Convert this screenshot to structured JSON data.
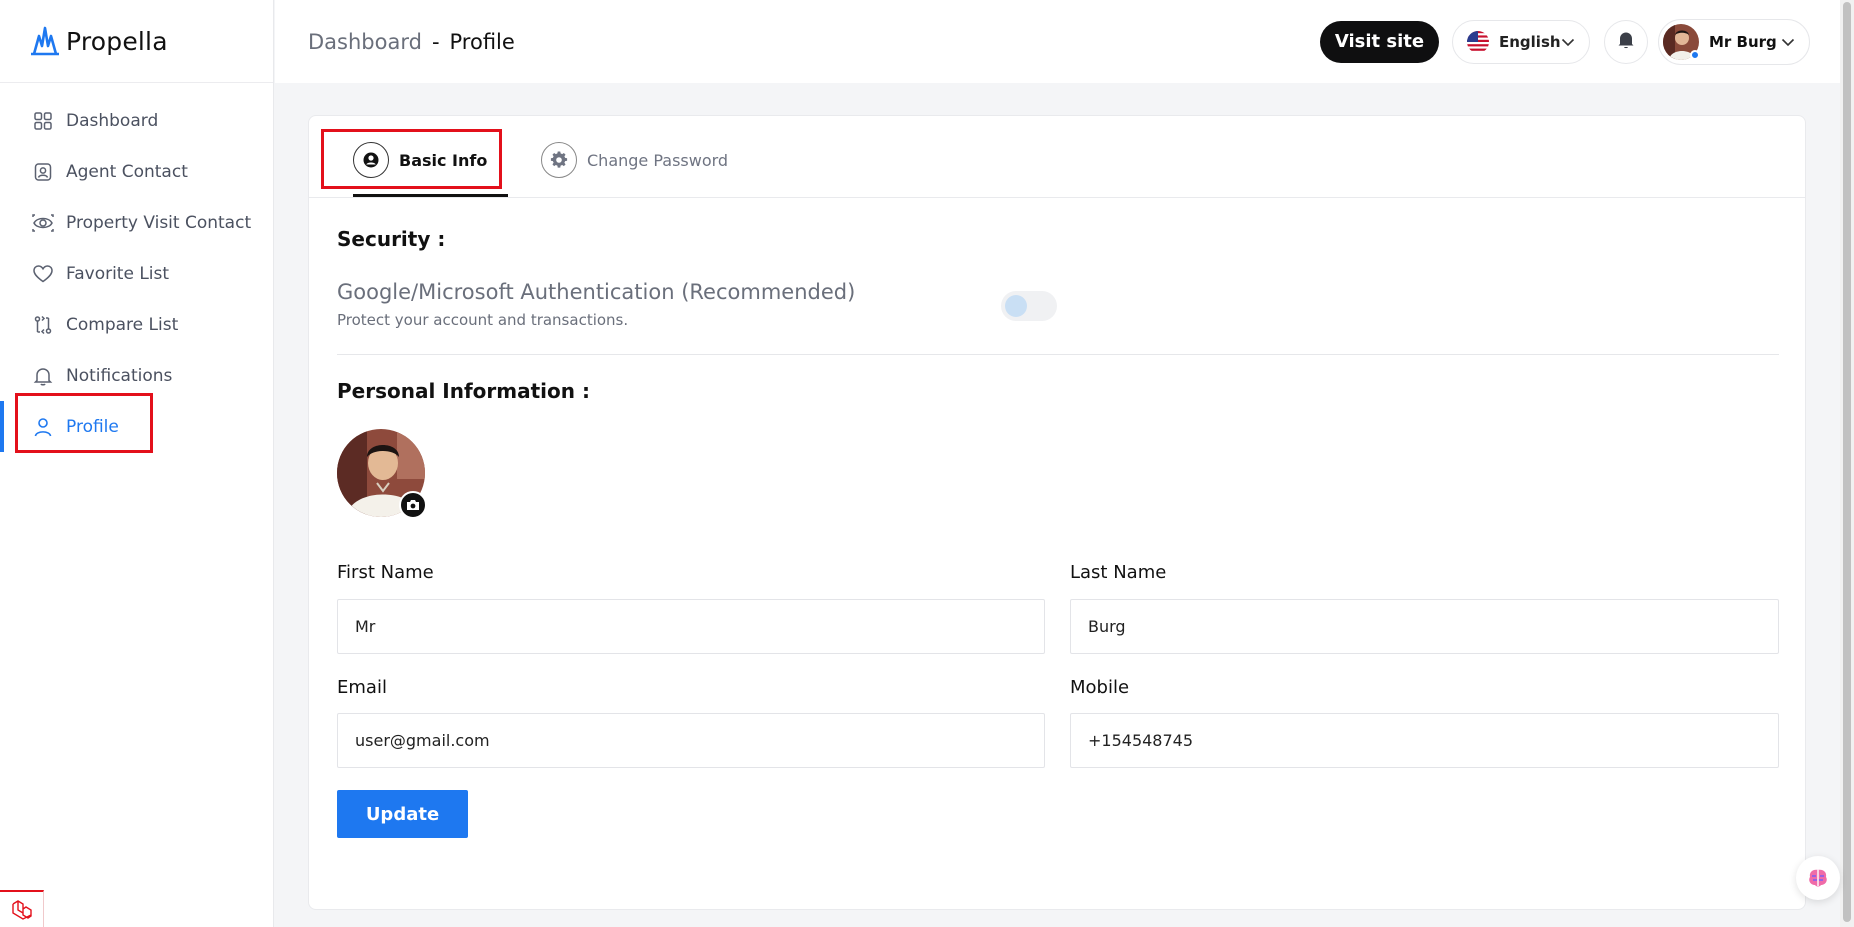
{
  "brand": {
    "name": "Propella",
    "logo_icon": "propella-logo-icon",
    "brand_color": "#1e78f0"
  },
  "sidebar": {
    "items": [
      {
        "label": "Dashboard",
        "icon": "grid-icon"
      },
      {
        "label": "Agent Contact",
        "icon": "contact-card-icon"
      },
      {
        "label": "Property Visit Contact",
        "icon": "eye-icon"
      },
      {
        "label": "Favorite List",
        "icon": "heart-icon"
      },
      {
        "label": "Compare List",
        "icon": "compare-icon"
      },
      {
        "label": "Notifications",
        "icon": "bell-icon"
      },
      {
        "label": "Profile",
        "icon": "user-icon",
        "active": true
      }
    ]
  },
  "header": {
    "breadcrumb_parent": "Dashboard",
    "breadcrumb_separator": "-",
    "breadcrumb_current": "Profile",
    "visit_site_label": "Visit site",
    "language": "English",
    "user_name": "Mr Burg"
  },
  "tabs": [
    {
      "label": "Basic Info",
      "icon": "user-circle-icon",
      "active": true
    },
    {
      "label": "Change Password",
      "icon": "gear-icon",
      "active": false
    }
  ],
  "security": {
    "title": "Security :",
    "auth_title": "Google/Microsoft Authentication (Recommended)",
    "auth_subtitle": "Protect your account and transactions.",
    "enabled": false
  },
  "personal": {
    "title": "Personal Information :",
    "first_name_label": "First Name",
    "first_name_value": "Mr",
    "last_name_label": "Last Name",
    "last_name_value": "Burg",
    "email_label": "Email",
    "email_value": "user@gmail.com",
    "mobile_label": "Mobile",
    "mobile_value": "+154548745"
  },
  "update_label": "Update",
  "colors": {
    "accent": "#1e78f0",
    "highlight": "#e3101b",
    "dark_button": "#0f0f10"
  }
}
